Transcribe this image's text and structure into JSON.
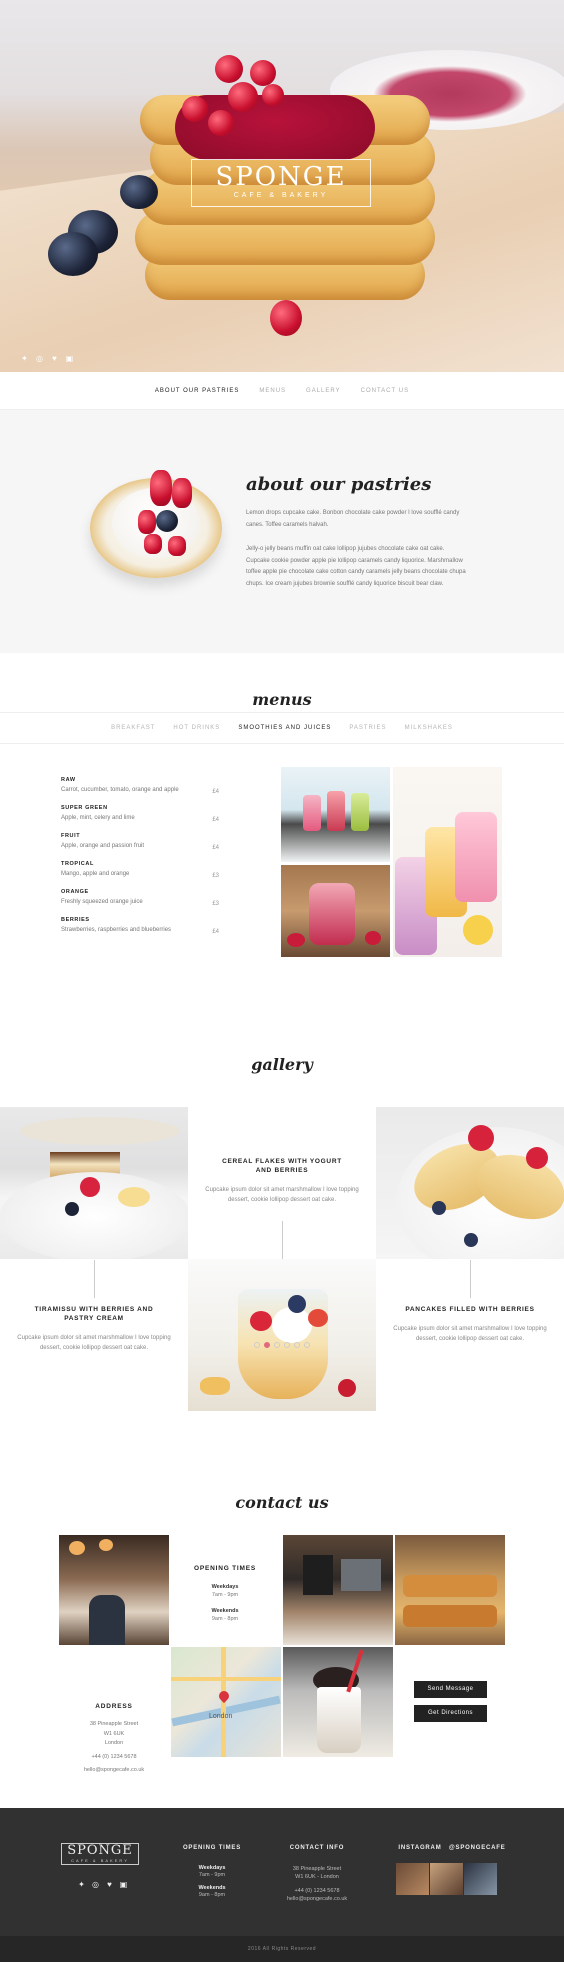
{
  "brand": {
    "name": "SPONGE",
    "tagline": "CAFE & BAKERY"
  },
  "nav": {
    "items": [
      {
        "label": "ABOUT OUR PASTRIES",
        "active": true
      },
      {
        "label": "MENUS",
        "active": false
      },
      {
        "label": "GALLERY",
        "active": false
      },
      {
        "label": "CONTACT US",
        "active": false
      }
    ]
  },
  "social_icons": [
    "twitter-icon",
    "dribbble-icon",
    "heart-icon",
    "instagram-icon"
  ],
  "about": {
    "title": "about our pastries",
    "paragraph1": "Lemon drops cupcake cake. Bonbon chocolate cake powder I love soufflé candy canes. Toffee caramels halvah.",
    "paragraph2": "Jelly-o jelly beans muffin oat cake lollipop jujubes chocolate cake oat cake. Cupcake cookie powder apple pie lollipop caramels candy liquorice. Marshmallow toffee apple pie chocolate cake cotton candy caramels jelly beans chocolate chupa chups. Ice cream jujubes brownie soufflé candy liquorice biscuit bear claw."
  },
  "menus": {
    "title": "menus",
    "tabs": [
      {
        "label": "BREAKFAST",
        "active": false
      },
      {
        "label": "HOT DRINKS",
        "active": false
      },
      {
        "label": "SMOOTHIES AND JUICES",
        "active": true
      },
      {
        "label": "PASTRIES",
        "active": false
      },
      {
        "label": "MILKSHAKES",
        "active": false
      }
    ],
    "items": [
      {
        "name": "RAW",
        "desc": "Carrot, cucumber, tomato, orange and apple",
        "price": "£4"
      },
      {
        "name": "SUPER GREEN",
        "desc": "Apple, mint, celery and lime",
        "price": "£4"
      },
      {
        "name": "FRUIT",
        "desc": "Apple, orange and passion fruit",
        "price": "£4"
      },
      {
        "name": "TROPICAL",
        "desc": "Mango, apple and orange",
        "price": "£3"
      },
      {
        "name": "ORANGE",
        "desc": "Freshly squeezed orange juice",
        "price": "£3"
      },
      {
        "name": "BERRIES",
        "desc": "Strawberries, raspberries and blueberries",
        "price": "£4"
      }
    ]
  },
  "gallery": {
    "title": "gallery",
    "items": [
      {
        "title": "CEREAL FLAKES WITH YOGURT AND BERRIES",
        "text": "Cupcake ipsum dolor sit amet marshmallow I love topping dessert, cookie lollipop dessert oat cake."
      },
      {
        "title": "TIRAMISSU WITH BERRIES AND PASTRY CREAM",
        "text": "Cupcake ipsum dolor sit amet marshmallow I love topping dessert, cookie lollipop dessert oat cake."
      },
      {
        "title": "PANCAKES FILLED WITH BERRIES",
        "text": "Cupcake ipsum dolor sit amet marshmallow I love topping dessert, cookie lollipop dessert oat cake."
      }
    ],
    "pagination": {
      "total": 6,
      "current": 2
    }
  },
  "contact": {
    "title": "contact us",
    "opening": {
      "heading": "OPENING TIMES",
      "weekdays_label": "Weekdays",
      "weekdays_hours": "7am - 9pm",
      "weekends_label": "Weekends",
      "weekends_hours": "9am - 8pm"
    },
    "address": {
      "heading": "ADDRESS",
      "line1": "38 Pineapple Street",
      "line2": "W1 6UK",
      "line3": "London",
      "phone": "+44 (0) 1234 5678",
      "email": "hello@spongecafe.co.uk"
    },
    "buttons": {
      "send": "Send Message",
      "directions": "Get Directions"
    },
    "map_label": "London"
  },
  "footer": {
    "opening": {
      "heading": "OPENING TIMES",
      "weekdays_label": "Weekdays",
      "weekdays_hours": "7am - 9pm",
      "weekends_label": "Weekends",
      "weekends_hours": "9am - 8pm"
    },
    "contact": {
      "heading": "CONTACT INFO",
      "line1": "38 Pineapple Street",
      "line2": "W1 6UK - London",
      "phone": "+44 (0) 1234 5678",
      "email": "hello@spongecafe.co.uk"
    },
    "instagram": {
      "heading": "INSTAGRAM",
      "handle": "@SPONGECAFE"
    },
    "copyright": "2016 All Rights Reserved"
  }
}
